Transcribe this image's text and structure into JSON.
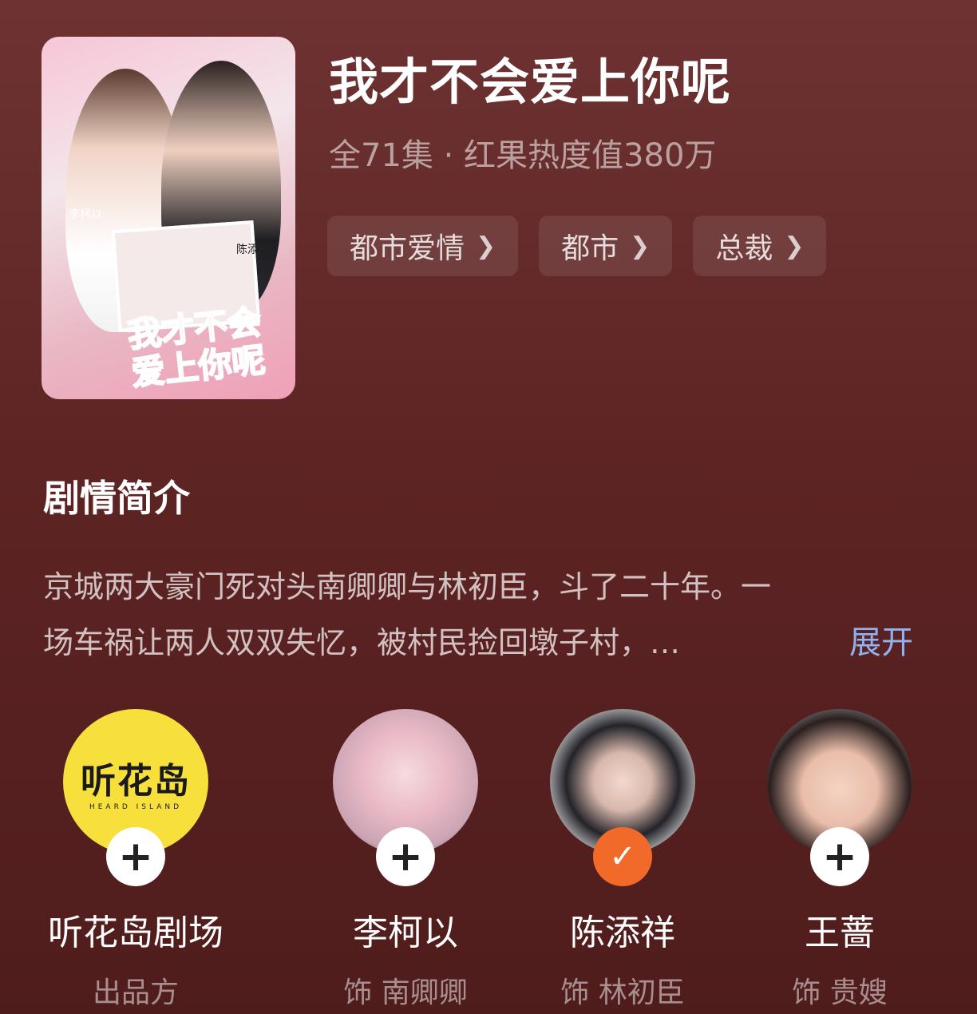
{
  "drama": {
    "title": "我才不会爱上你呢",
    "meta": "全71集 · 红果热度值380万",
    "poster_title_text": "我才不会爱上你呢",
    "poster_cast_a": "李柯以",
    "poster_cast_b": "陈添祥",
    "tags": [
      {
        "label": "都市爱情"
      },
      {
        "label": "都市"
      },
      {
        "label": "总裁"
      }
    ]
  },
  "synopsis": {
    "heading": "剧情简介",
    "line1": "京城两大豪门死对头南卿卿与林初臣，斗了二十年。一",
    "line2": "场车祸让两人双双失忆，被村民捡回墩子村，…",
    "expand_label": "展开"
  },
  "people": [
    {
      "name": "听花岛剧场",
      "role": "出品方",
      "avatar_text": "听花岛",
      "avatar_sub": "HEARD ISLAND",
      "badge": "+",
      "followed": false
    },
    {
      "name": "李柯以",
      "role": "饰 南卿卿",
      "badge": "+",
      "followed": false
    },
    {
      "name": "陈添祥",
      "role": "饰 林初臣",
      "badge": "✓",
      "followed": true
    },
    {
      "name": "王蔷",
      "role": "饰 贵嫂",
      "badge": "+",
      "followed": false
    }
  ],
  "colors": {
    "background": "#5e2424",
    "accent_link": "#8fb3f0",
    "followed_badge": "#f26a2a",
    "studio_avatar": "#f7e03b"
  }
}
